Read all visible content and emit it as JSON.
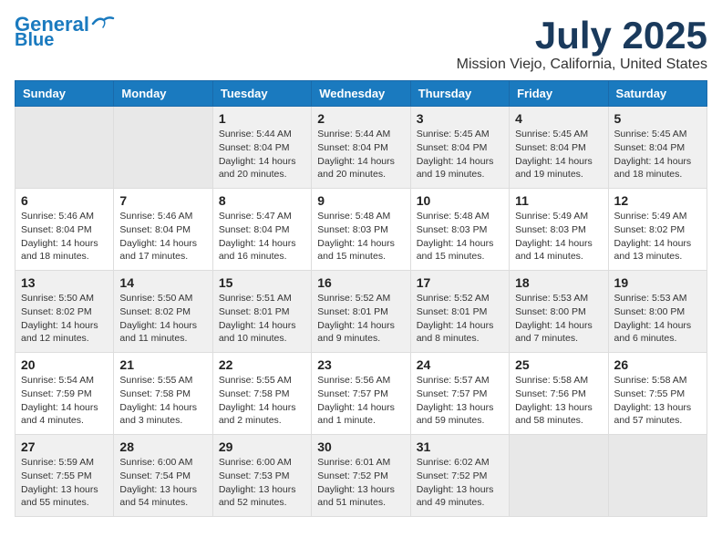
{
  "header": {
    "logo_line1": "General",
    "logo_line2": "Blue",
    "month_year": "July 2025",
    "location": "Mission Viejo, California, United States"
  },
  "weekdays": [
    "Sunday",
    "Monday",
    "Tuesday",
    "Wednesday",
    "Thursday",
    "Friday",
    "Saturday"
  ],
  "weeks": [
    [
      {
        "day": "",
        "content": ""
      },
      {
        "day": "",
        "content": ""
      },
      {
        "day": "1",
        "content": "Sunrise: 5:44 AM\nSunset: 8:04 PM\nDaylight: 14 hours and 20 minutes."
      },
      {
        "day": "2",
        "content": "Sunrise: 5:44 AM\nSunset: 8:04 PM\nDaylight: 14 hours and 20 minutes."
      },
      {
        "day": "3",
        "content": "Sunrise: 5:45 AM\nSunset: 8:04 PM\nDaylight: 14 hours and 19 minutes."
      },
      {
        "day": "4",
        "content": "Sunrise: 5:45 AM\nSunset: 8:04 PM\nDaylight: 14 hours and 19 minutes."
      },
      {
        "day": "5",
        "content": "Sunrise: 5:45 AM\nSunset: 8:04 PM\nDaylight: 14 hours and 18 minutes."
      }
    ],
    [
      {
        "day": "6",
        "content": "Sunrise: 5:46 AM\nSunset: 8:04 PM\nDaylight: 14 hours and 18 minutes."
      },
      {
        "day": "7",
        "content": "Sunrise: 5:46 AM\nSunset: 8:04 PM\nDaylight: 14 hours and 17 minutes."
      },
      {
        "day": "8",
        "content": "Sunrise: 5:47 AM\nSunset: 8:04 PM\nDaylight: 14 hours and 16 minutes."
      },
      {
        "day": "9",
        "content": "Sunrise: 5:48 AM\nSunset: 8:03 PM\nDaylight: 14 hours and 15 minutes."
      },
      {
        "day": "10",
        "content": "Sunrise: 5:48 AM\nSunset: 8:03 PM\nDaylight: 14 hours and 15 minutes."
      },
      {
        "day": "11",
        "content": "Sunrise: 5:49 AM\nSunset: 8:03 PM\nDaylight: 14 hours and 14 minutes."
      },
      {
        "day": "12",
        "content": "Sunrise: 5:49 AM\nSunset: 8:02 PM\nDaylight: 14 hours and 13 minutes."
      }
    ],
    [
      {
        "day": "13",
        "content": "Sunrise: 5:50 AM\nSunset: 8:02 PM\nDaylight: 14 hours and 12 minutes."
      },
      {
        "day": "14",
        "content": "Sunrise: 5:50 AM\nSunset: 8:02 PM\nDaylight: 14 hours and 11 minutes."
      },
      {
        "day": "15",
        "content": "Sunrise: 5:51 AM\nSunset: 8:01 PM\nDaylight: 14 hours and 10 minutes."
      },
      {
        "day": "16",
        "content": "Sunrise: 5:52 AM\nSunset: 8:01 PM\nDaylight: 14 hours and 9 minutes."
      },
      {
        "day": "17",
        "content": "Sunrise: 5:52 AM\nSunset: 8:01 PM\nDaylight: 14 hours and 8 minutes."
      },
      {
        "day": "18",
        "content": "Sunrise: 5:53 AM\nSunset: 8:00 PM\nDaylight: 14 hours and 7 minutes."
      },
      {
        "day": "19",
        "content": "Sunrise: 5:53 AM\nSunset: 8:00 PM\nDaylight: 14 hours and 6 minutes."
      }
    ],
    [
      {
        "day": "20",
        "content": "Sunrise: 5:54 AM\nSunset: 7:59 PM\nDaylight: 14 hours and 4 minutes."
      },
      {
        "day": "21",
        "content": "Sunrise: 5:55 AM\nSunset: 7:58 PM\nDaylight: 14 hours and 3 minutes."
      },
      {
        "day": "22",
        "content": "Sunrise: 5:55 AM\nSunset: 7:58 PM\nDaylight: 14 hours and 2 minutes."
      },
      {
        "day": "23",
        "content": "Sunrise: 5:56 AM\nSunset: 7:57 PM\nDaylight: 14 hours and 1 minute."
      },
      {
        "day": "24",
        "content": "Sunrise: 5:57 AM\nSunset: 7:57 PM\nDaylight: 13 hours and 59 minutes."
      },
      {
        "day": "25",
        "content": "Sunrise: 5:58 AM\nSunset: 7:56 PM\nDaylight: 13 hours and 58 minutes."
      },
      {
        "day": "26",
        "content": "Sunrise: 5:58 AM\nSunset: 7:55 PM\nDaylight: 13 hours and 57 minutes."
      }
    ],
    [
      {
        "day": "27",
        "content": "Sunrise: 5:59 AM\nSunset: 7:55 PM\nDaylight: 13 hours and 55 minutes."
      },
      {
        "day": "28",
        "content": "Sunrise: 6:00 AM\nSunset: 7:54 PM\nDaylight: 13 hours and 54 minutes."
      },
      {
        "day": "29",
        "content": "Sunrise: 6:00 AM\nSunset: 7:53 PM\nDaylight: 13 hours and 52 minutes."
      },
      {
        "day": "30",
        "content": "Sunrise: 6:01 AM\nSunset: 7:52 PM\nDaylight: 13 hours and 51 minutes."
      },
      {
        "day": "31",
        "content": "Sunrise: 6:02 AM\nSunset: 7:52 PM\nDaylight: 13 hours and 49 minutes."
      },
      {
        "day": "",
        "content": ""
      },
      {
        "day": "",
        "content": ""
      }
    ]
  ]
}
